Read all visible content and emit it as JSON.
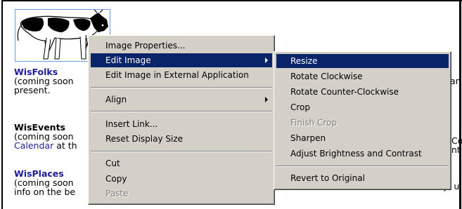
{
  "document": {
    "sections": [
      {
        "title": "WisFolks",
        "line1": "(coming soon",
        "line1_right": "an",
        "line2": "present."
      },
      {
        "title": "WisEvents",
        "line1": "(coming soon",
        "line1_right": "Co",
        "line2_link": "Calendar",
        "line2_rest": " at th",
        "line2_right": "nt"
      },
      {
        "title": "WisPlaces",
        "line1": "(coming soon",
        "line1_right": "y, u",
        "line2": "info on the be"
      }
    ]
  },
  "context_menu": {
    "items": [
      {
        "label": "Image Properties..."
      },
      {
        "label": "Edit Image",
        "submenu": true,
        "highlighted": true
      },
      {
        "label": "Edit Image in External Application"
      },
      {
        "label": "Align",
        "submenu": true
      },
      {
        "label": "Insert Link..."
      },
      {
        "label": "Reset Display Size"
      },
      {
        "label": "Cut"
      },
      {
        "label": "Copy"
      },
      {
        "label": "Paste",
        "disabled": true
      }
    ]
  },
  "edit_image_submenu": {
    "items": [
      {
        "label": "Resize",
        "highlighted": true
      },
      {
        "label": "Rotate Clockwise"
      },
      {
        "label": "Rotate Counter-Clockwise"
      },
      {
        "label": "Crop"
      },
      {
        "label": "Finish Crop",
        "disabled": true
      },
      {
        "label": "Sharpen"
      },
      {
        "label": "Adjust Brightness and Contrast"
      },
      {
        "label": "Revert to Original"
      }
    ]
  },
  "colors": {
    "menu_bg": "#d4d0c8",
    "highlight": "#0a246a",
    "link": "#1c1c9c"
  },
  "icons": [
    "cow-image"
  ]
}
